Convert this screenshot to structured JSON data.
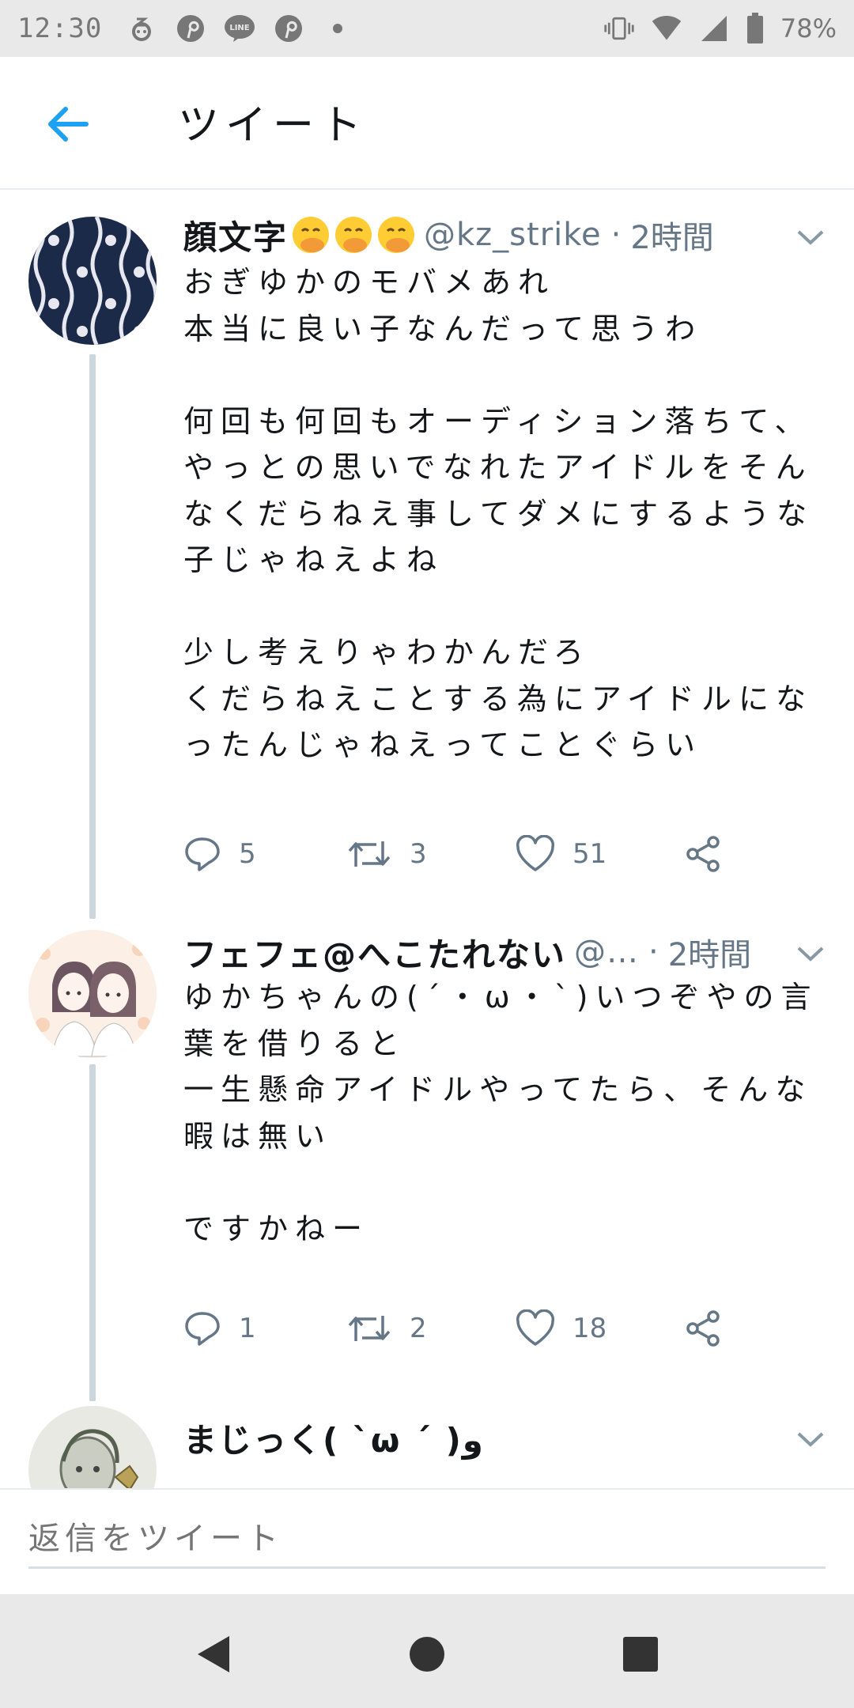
{
  "status_bar": {
    "time": "12:30",
    "battery": "78%",
    "icons_left": [
      "sleep-icon",
      "pinterest-icon",
      "line-icon",
      "pinterest-icon",
      "dot-icon"
    ],
    "icons_right": [
      "vibrate-icon",
      "wifi-icon",
      "signal-icon",
      "battery-icon"
    ]
  },
  "header": {
    "title": "ツイート",
    "back_icon": "arrow-left-icon",
    "accent": "#1da1f2"
  },
  "tweets": [
    {
      "name": "顔文字",
      "emoji": [
        "face-with-hand-over-mouth-icon",
        "face-with-hand-over-mouth-icon",
        "face-with-hand-over-mouth-icon"
      ],
      "handle": "@kz_strike",
      "separator": "·",
      "time": "2時間",
      "text": "おぎゆかのモバメあれ\n本当に良い子なんだって思うわ\n\n何回も何回もオーディション落ちて、やっとの思いでなれたアイドルをそんなくだらねえ事してダメにするような子じゃねえよね\n\n少し考えりゃわかんだろ\nくだらねえことする為にアイドルになったんじゃねえってことぐらい",
      "replies": "5",
      "retweets": "3",
      "likes": "51"
    },
    {
      "name": "フェフェ@へこたれない",
      "handle": "@…",
      "separator": "·",
      "time": "2時間",
      "text": "ゆかちゃんの(´・ω・`)いつぞやの言葉を借りると\n一生懸命アイドルやってたら、そんな暇は無い\n\nですかねー",
      "replies": "1",
      "retweets": "2",
      "likes": "18"
    },
    {
      "name": "まじっく( ˋ̀ω ˊ́ )و"
    }
  ],
  "reply": {
    "placeholder": "返信をツイート"
  },
  "nav": {
    "icons": [
      "back-triangle-icon",
      "home-circle-icon",
      "recents-square-icon"
    ]
  },
  "colors": {
    "secondary_text": "#657786",
    "thread_line": "#ccd6dd"
  }
}
